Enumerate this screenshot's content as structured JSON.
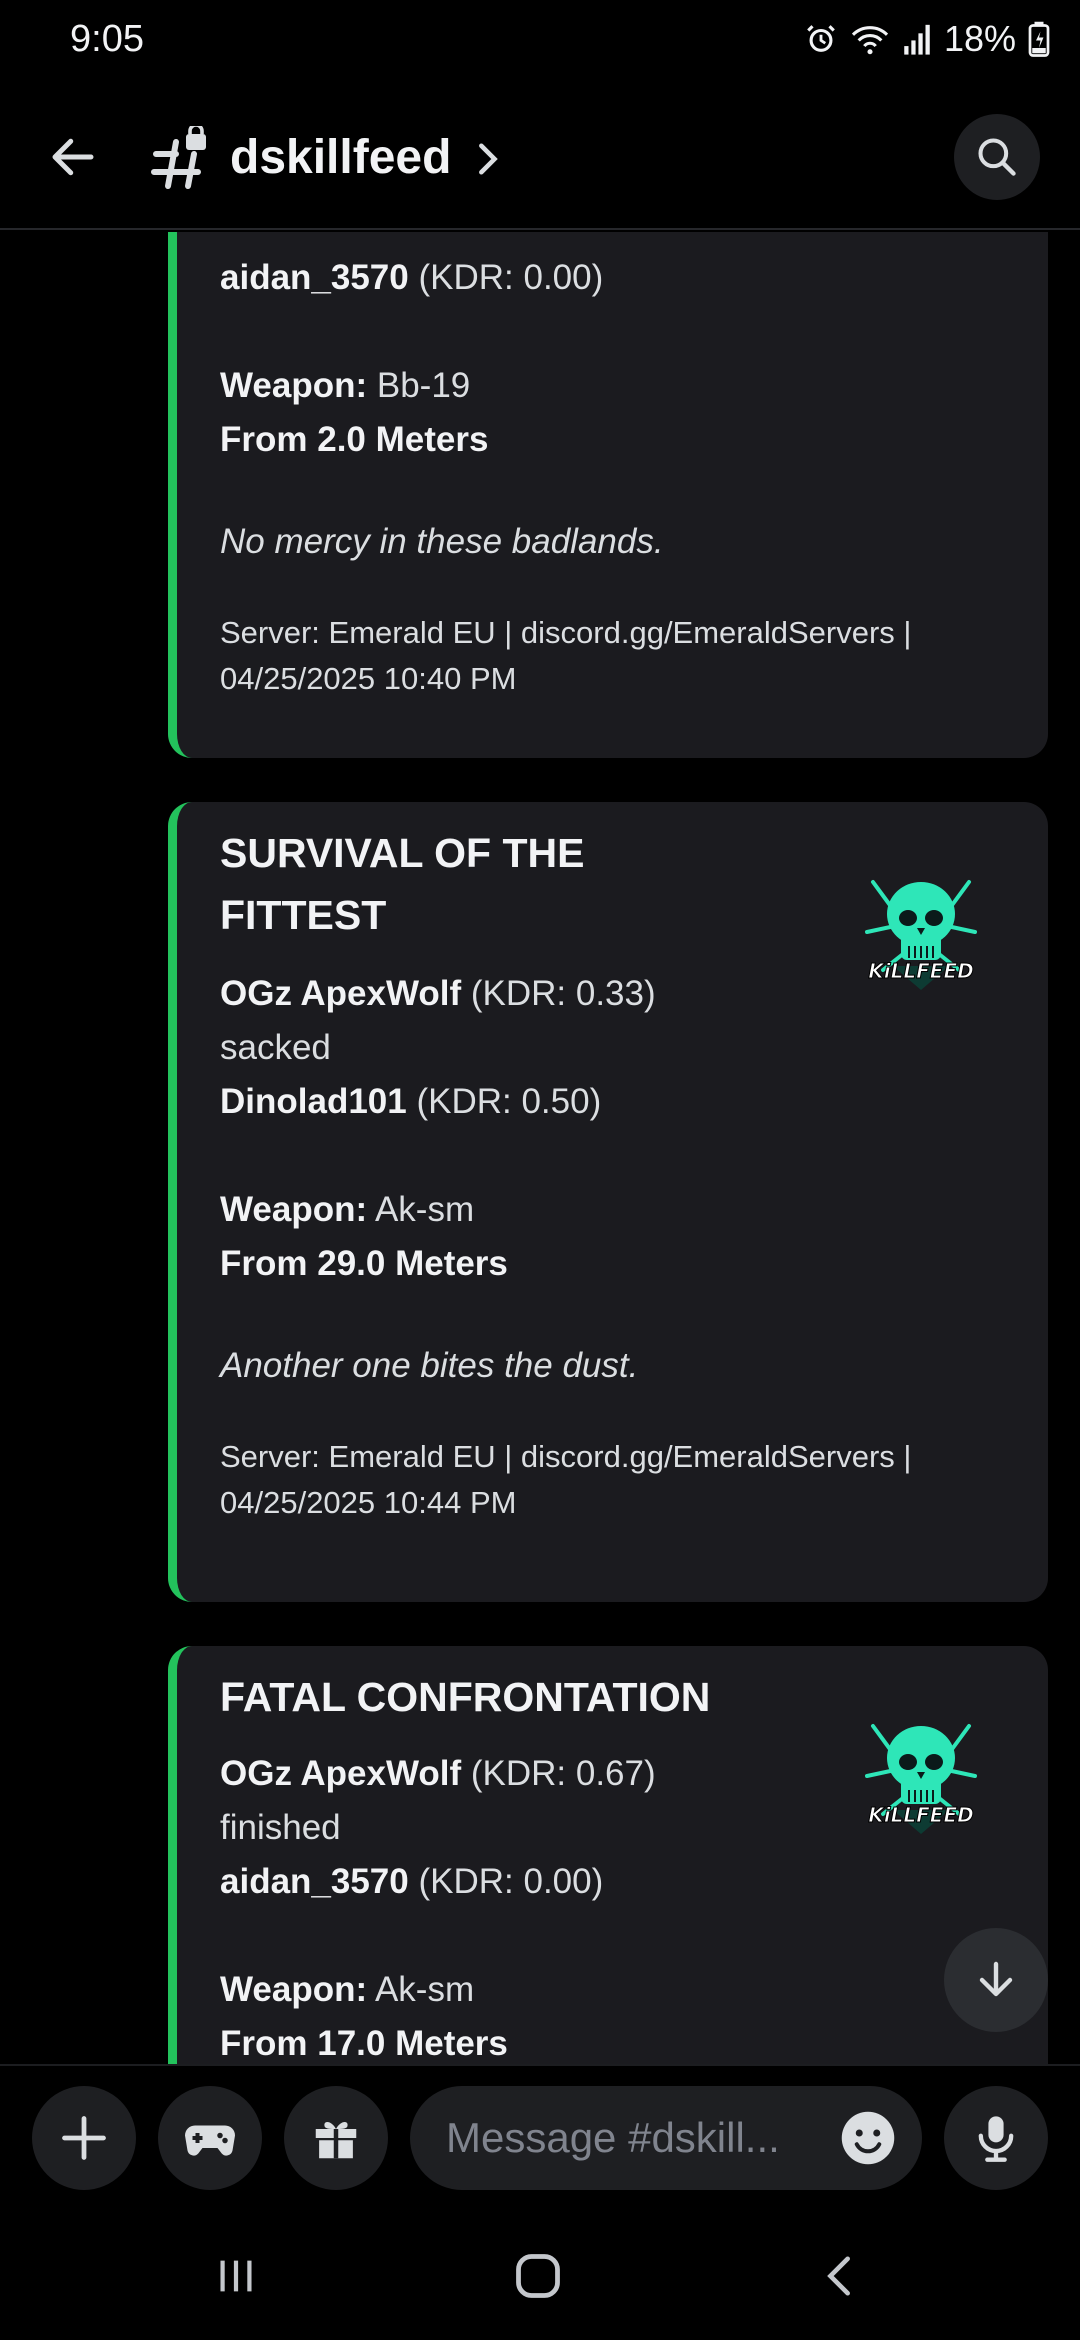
{
  "status_bar": {
    "time": "9:05",
    "battery": "18%"
  },
  "header": {
    "channel_name": "dskillfeed"
  },
  "messages": [
    {
      "killer_line": "aidan_3570",
      "killer_kdr": "(KDR: 0.00)",
      "weapon_label": "Weapon:",
      "weapon": "Bb-19",
      "distance": "From 2.0 Meters",
      "quote": "No mercy in these badlands.",
      "footer": "Server: Emerald EU | discord.gg/EmeraldServers | 04/25/2025 10:40 PM"
    },
    {
      "title": "SURVIVAL OF THE FITTEST",
      "killer": "OGz ApexWolf",
      "killer_kdr": "(KDR: 0.33)",
      "verb": "sacked",
      "victim": "Dinolad101",
      "victim_kdr": "(KDR: 0.50)",
      "weapon_label": "Weapon:",
      "weapon": "Ak-sm",
      "distance": "From 29.0 Meters",
      "quote": "Another one bites the dust.",
      "footer": "Server: Emerald EU | discord.gg/EmeraldServers | 04/25/2025 10:44 PM",
      "thumb_text": "KiLLFEED"
    },
    {
      "title": "FATAL CONFRONTATION",
      "killer": "OGz ApexWolf",
      "killer_kdr": "(KDR: 0.67)",
      "verb": "finished",
      "victim": "aidan_3570",
      "victim_kdr": "(KDR: 0.00)",
      "weapon_label": "Weapon:",
      "weapon": "Ak-sm",
      "distance": "From 17.0 Meters",
      "thumb_text": "KiLLFEED"
    }
  ],
  "composer": {
    "placeholder": "Message #dskill..."
  },
  "colors": {
    "embed_accent": "#23c25c",
    "embed_bg": "#1b1b1f",
    "skull": "#2ee6b8"
  }
}
